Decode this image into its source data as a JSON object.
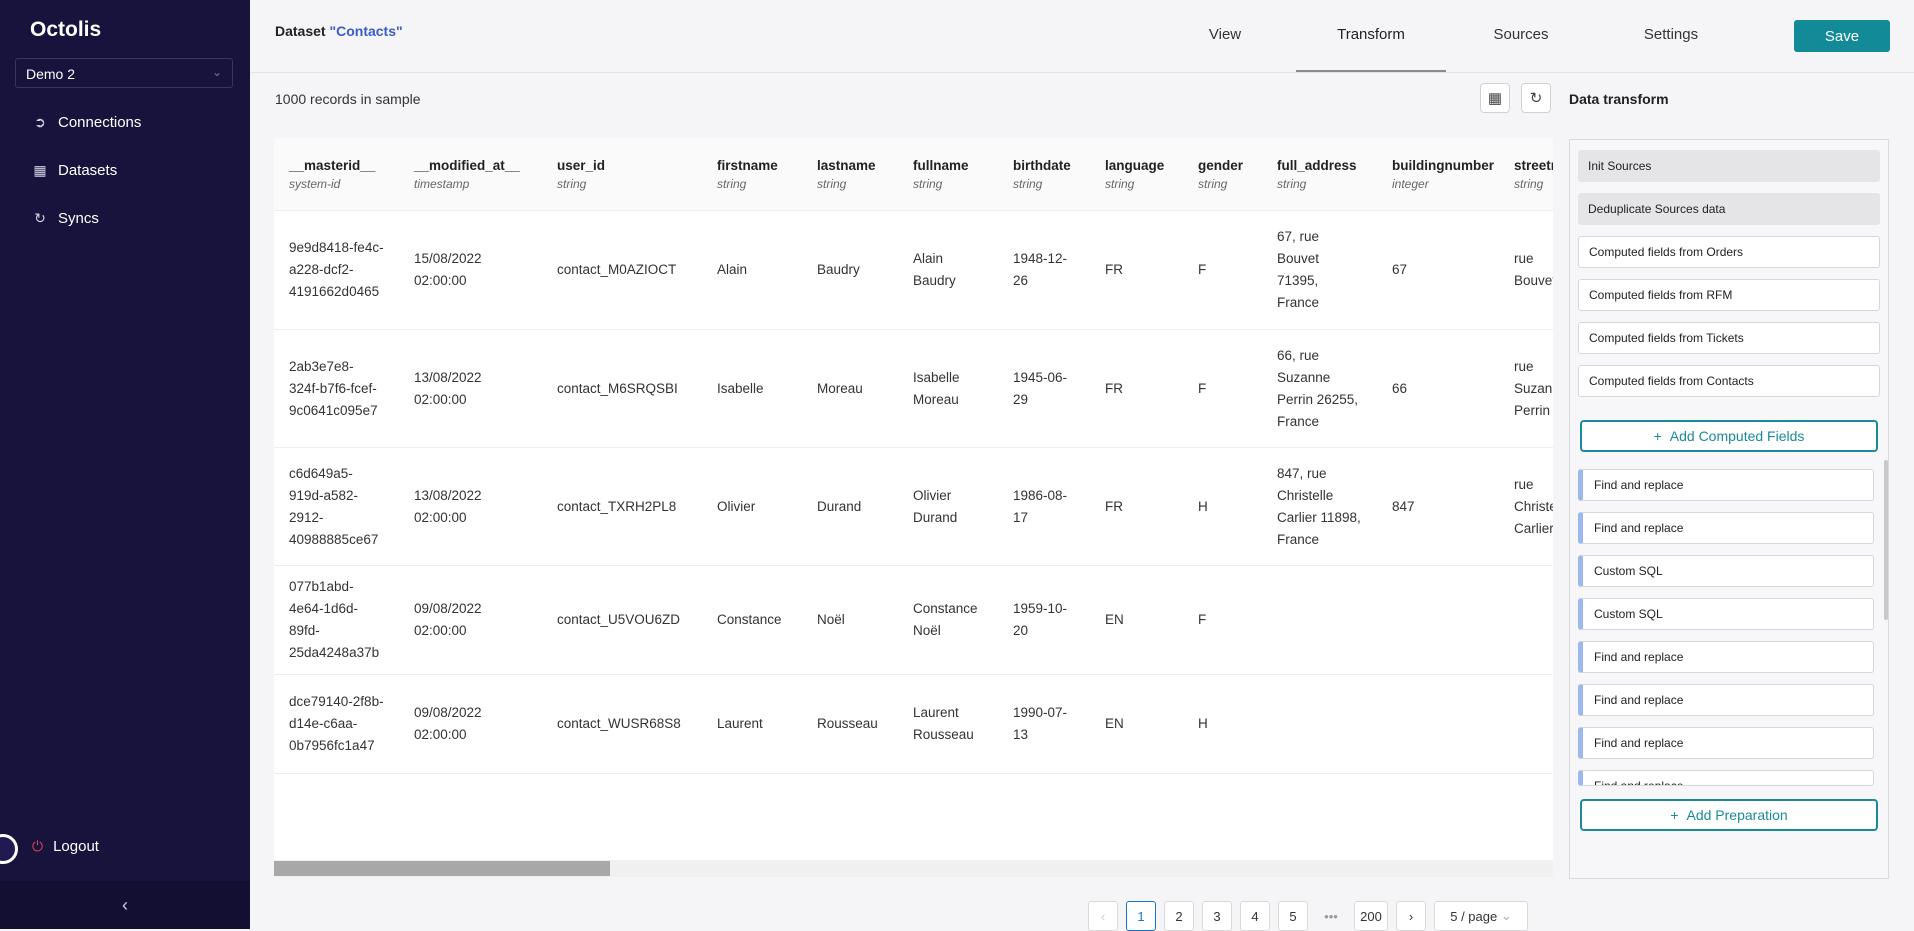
{
  "app": {
    "logo": "Octolis",
    "project": "Demo 2"
  },
  "sidebar": {
    "items": [
      {
        "label": "Connections",
        "icon": "connections-icon"
      },
      {
        "label": "Datasets",
        "icon": "datasets-icon"
      },
      {
        "label": "Syncs",
        "icon": "syncs-icon"
      }
    ],
    "logout": "Logout"
  },
  "header": {
    "dataset_prefix": "Dataset ",
    "dataset_name": "\"Contacts\"",
    "tabs": [
      "View",
      "Transform",
      "Sources",
      "Settings"
    ],
    "active_tab": "Transform",
    "save": "Save"
  },
  "table": {
    "records_text": "1000 records in sample",
    "columns": [
      {
        "name": "__masterid__",
        "type": "system-id"
      },
      {
        "name": "__modified_at__",
        "type": "timestamp"
      },
      {
        "name": "user_id",
        "type": "string"
      },
      {
        "name": "firstname",
        "type": "string"
      },
      {
        "name": "lastname",
        "type": "string"
      },
      {
        "name": "fullname",
        "type": "string"
      },
      {
        "name": "birthdate",
        "type": "string"
      },
      {
        "name": "language",
        "type": "string"
      },
      {
        "name": "gender",
        "type": "string"
      },
      {
        "name": "full_address",
        "type": "string"
      },
      {
        "name": "buildingnumber",
        "type": "integer"
      },
      {
        "name": "streetname",
        "type": "string"
      }
    ],
    "rows": [
      [
        "9e9d8418-fe4c-a228-dcf2-4191662d0465",
        "15/08/2022 02:00:00",
        "contact_M0AZIOCT",
        "Alain",
        "Baudry",
        "Alain Baudry",
        "1948-12-26",
        "FR",
        "F",
        "67, rue Bouvet 71395, France",
        "67",
        "rue Bouvet"
      ],
      [
        "2ab3e7e8-324f-b7f6-fcef-9c0641c095e7",
        "13/08/2022 02:00:00",
        "contact_M6SRQSBI",
        "Isabelle",
        "Moreau",
        "Isabelle Moreau",
        "1945-06-29",
        "FR",
        "F",
        "66, rue Suzanne Perrin 26255, France",
        "66",
        "rue Suzanne Perrin"
      ],
      [
        "c6d649a5-919d-a582-2912-40988885ce67",
        "13/08/2022 02:00:00",
        "contact_TXRH2PL8",
        "Olivier",
        "Durand",
        "Olivier Durand",
        "1986-08-17",
        "FR",
        "H",
        "847, rue Christelle Carlier 11898, France",
        "847",
        "rue Christelle Carlier"
      ],
      [
        "077b1abd-4e64-1d6d-89fd-25da4248a37b",
        "09/08/2022 02:00:00",
        "contact_U5VOU6ZD",
        "Constance",
        "Noël",
        "Constance Noël",
        "1959-10-20",
        "EN",
        "F",
        "",
        "",
        ""
      ],
      [
        "dce79140-2f8b-d14e-c6aa-0b7956fc1a47",
        "09/08/2022 02:00:00",
        "contact_WUSR68S8",
        "Laurent",
        "Rousseau",
        "Laurent Rousseau",
        "1990-07-13",
        "EN",
        "H",
        "",
        "",
        ""
      ]
    ]
  },
  "pagination": {
    "pages": [
      "1",
      "2",
      "3",
      "4",
      "5"
    ],
    "ellipsis": "•••",
    "last": "200",
    "current": "1",
    "page_size": "5 / page"
  },
  "transform": {
    "title": "Data transform",
    "init_steps": [
      "Init Sources",
      "Deduplicate Sources data"
    ],
    "computed_steps": [
      "Computed fields from Orders",
      "Computed fields from RFM",
      "Computed fields from Tickets",
      "Computed fields from Contacts"
    ],
    "add_computed": "Add Computed Fields",
    "prep_steps": [
      "Find and replace",
      "Find and replace",
      "Custom SQL",
      "Custom SQL",
      "Find and replace",
      "Find and replace",
      "Find and replace",
      "Find and replace"
    ],
    "add_prep": "Add Preparation"
  },
  "colors": {
    "sidebar": "#17133c",
    "accent": "#128a98",
    "link": "#3b5bc9"
  }
}
